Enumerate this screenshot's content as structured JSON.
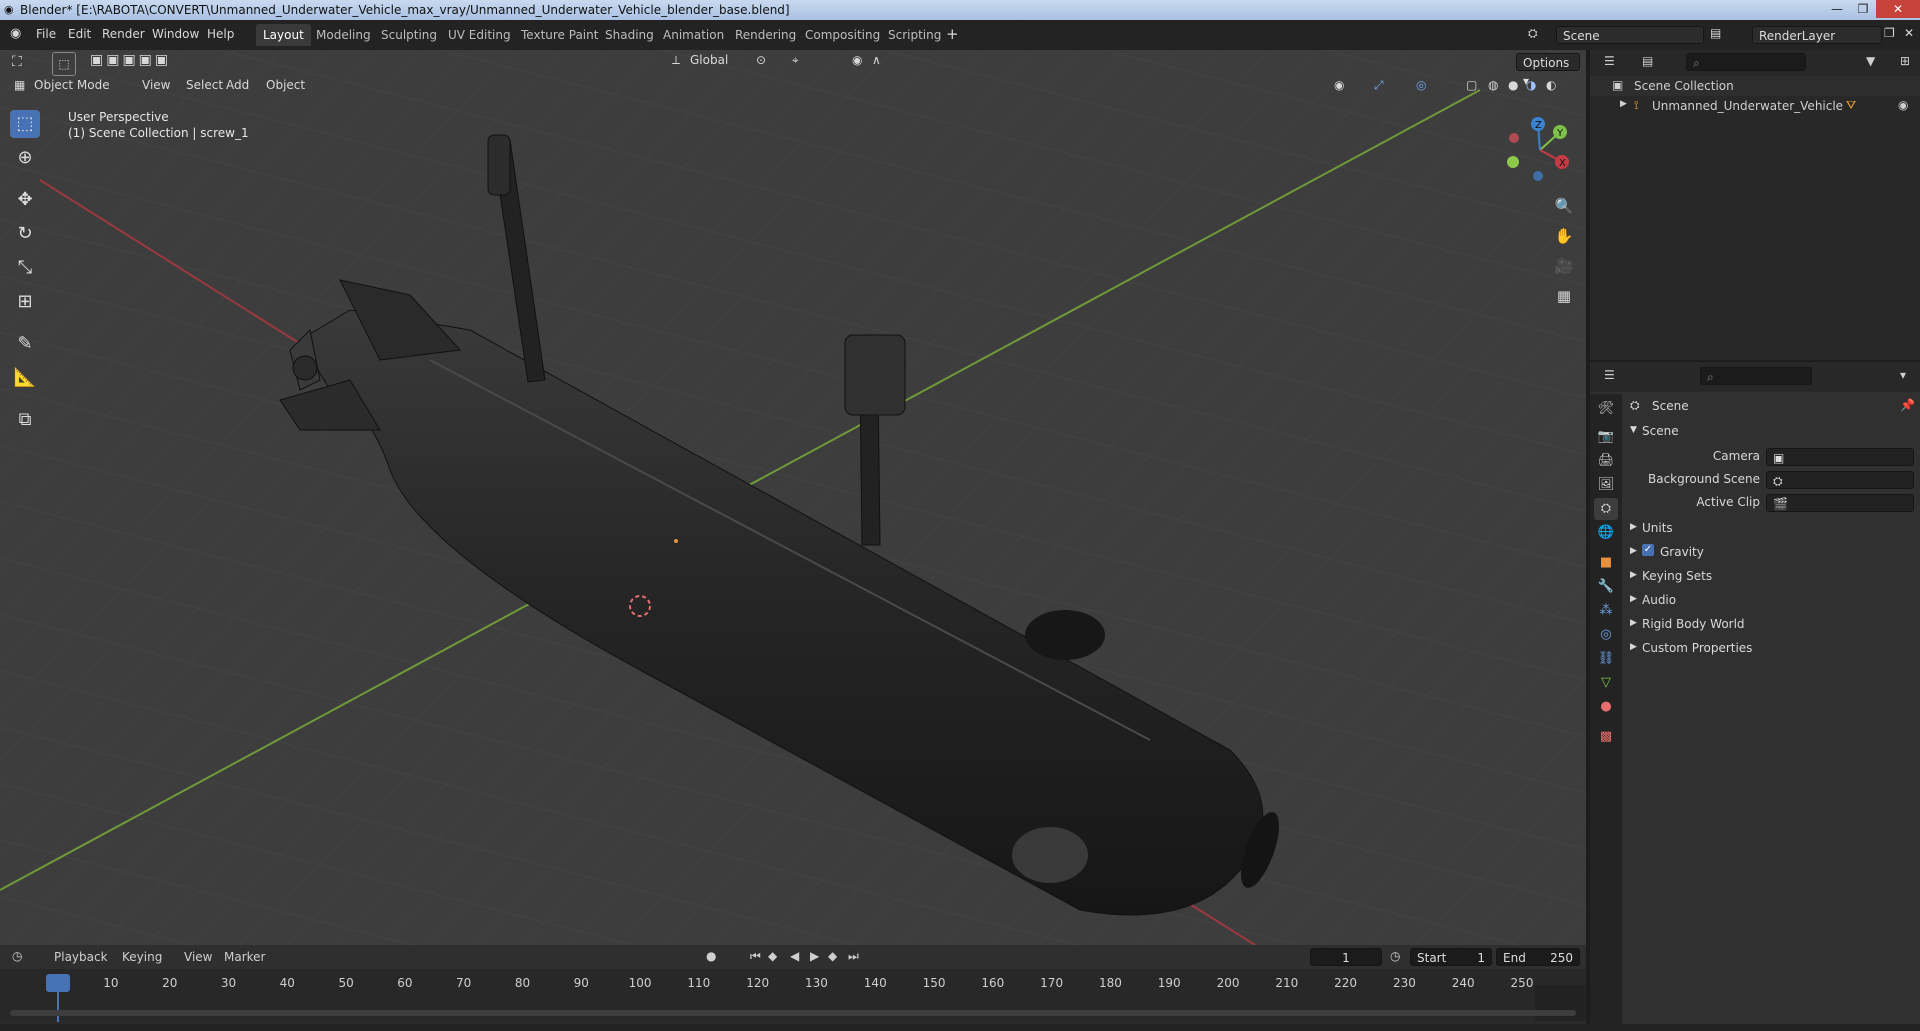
{
  "window": {
    "title": "Blender* [E:\\RABOTA\\CONVERT\\Unmanned_Underwater_Vehicle_max_vray/Unmanned_Underwater_Vehicle_blender_base.blend]"
  },
  "menu": [
    "File",
    "Edit",
    "Render",
    "Window",
    "Help"
  ],
  "workspaces": [
    "Layout",
    "Modeling",
    "Sculpting",
    "UV Editing",
    "Texture Paint",
    "Shading",
    "Animation",
    "Rendering",
    "Compositing",
    "Scripting"
  ],
  "active_workspace": "Layout",
  "scene_selector": {
    "value": "Scene"
  },
  "render_layer_selector": {
    "value": "RenderLayer"
  },
  "viewport_header": {
    "transform_orientation": "Global",
    "options_label": "Options",
    "mode": "Object Mode",
    "menus": [
      "View",
      "Select",
      "Add",
      "Object"
    ]
  },
  "viewport_overlay": {
    "perspective": "User Perspective",
    "collection_info": "(1) Scene Collection | screw_1"
  },
  "gizmo": {
    "x": "X",
    "y": "Y",
    "z": "Z"
  },
  "outliner": {
    "root": "Scene Collection",
    "items": [
      {
        "label": "Unmanned_Underwater_Vehicle"
      }
    ]
  },
  "properties": {
    "context": "Scene",
    "section": "Scene",
    "fields": {
      "camera": "Camera",
      "background_scene": "Background Scene",
      "active_clip": "Active Clip"
    },
    "panels": [
      "Units",
      "Gravity",
      "Keying Sets",
      "Audio",
      "Rigid Body World",
      "Custom Properties"
    ],
    "gravity_checked": true
  },
  "timeline": {
    "menus": [
      "Playback",
      "Keying",
      "View",
      "Marker"
    ],
    "current_frame": "1",
    "start_label": "Start",
    "start": "1",
    "end_label": "End",
    "end": "250",
    "ticks": [
      "1",
      "10",
      "20",
      "30",
      "40",
      "50",
      "60",
      "70",
      "80",
      "90",
      "100",
      "110",
      "120",
      "130",
      "140",
      "150",
      "160",
      "170",
      "180",
      "190",
      "200",
      "210",
      "220",
      "230",
      "240",
      "250"
    ]
  },
  "colors": {
    "accent": "#4772b3",
    "x_axis": "#c63a44",
    "y_axis": "#7ec24a",
    "z_axis": "#3a82d4",
    "playhead": "#4772b3"
  }
}
